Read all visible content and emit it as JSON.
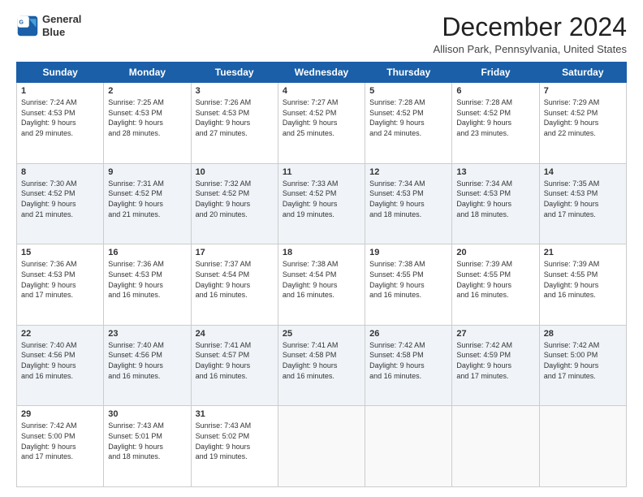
{
  "header": {
    "logo_line1": "General",
    "logo_line2": "Blue",
    "month": "December 2024",
    "location": "Allison Park, Pennsylvania, United States"
  },
  "days_of_week": [
    "Sunday",
    "Monday",
    "Tuesday",
    "Wednesday",
    "Thursday",
    "Friday",
    "Saturday"
  ],
  "weeks": [
    [
      {
        "day": "1",
        "lines": [
          "Sunrise: 7:24 AM",
          "Sunset: 4:53 PM",
          "Daylight: 9 hours",
          "and 29 minutes."
        ]
      },
      {
        "day": "2",
        "lines": [
          "Sunrise: 7:25 AM",
          "Sunset: 4:53 PM",
          "Daylight: 9 hours",
          "and 28 minutes."
        ]
      },
      {
        "day": "3",
        "lines": [
          "Sunrise: 7:26 AM",
          "Sunset: 4:53 PM",
          "Daylight: 9 hours",
          "and 27 minutes."
        ]
      },
      {
        "day": "4",
        "lines": [
          "Sunrise: 7:27 AM",
          "Sunset: 4:52 PM",
          "Daylight: 9 hours",
          "and 25 minutes."
        ]
      },
      {
        "day": "5",
        "lines": [
          "Sunrise: 7:28 AM",
          "Sunset: 4:52 PM",
          "Daylight: 9 hours",
          "and 24 minutes."
        ]
      },
      {
        "day": "6",
        "lines": [
          "Sunrise: 7:28 AM",
          "Sunset: 4:52 PM",
          "Daylight: 9 hours",
          "and 23 minutes."
        ]
      },
      {
        "day": "7",
        "lines": [
          "Sunrise: 7:29 AM",
          "Sunset: 4:52 PM",
          "Daylight: 9 hours",
          "and 22 minutes."
        ]
      }
    ],
    [
      {
        "day": "8",
        "lines": [
          "Sunrise: 7:30 AM",
          "Sunset: 4:52 PM",
          "Daylight: 9 hours",
          "and 21 minutes."
        ]
      },
      {
        "day": "9",
        "lines": [
          "Sunrise: 7:31 AM",
          "Sunset: 4:52 PM",
          "Daylight: 9 hours",
          "and 21 minutes."
        ]
      },
      {
        "day": "10",
        "lines": [
          "Sunrise: 7:32 AM",
          "Sunset: 4:52 PM",
          "Daylight: 9 hours",
          "and 20 minutes."
        ]
      },
      {
        "day": "11",
        "lines": [
          "Sunrise: 7:33 AM",
          "Sunset: 4:52 PM",
          "Daylight: 9 hours",
          "and 19 minutes."
        ]
      },
      {
        "day": "12",
        "lines": [
          "Sunrise: 7:34 AM",
          "Sunset: 4:53 PM",
          "Daylight: 9 hours",
          "and 18 minutes."
        ]
      },
      {
        "day": "13",
        "lines": [
          "Sunrise: 7:34 AM",
          "Sunset: 4:53 PM",
          "Daylight: 9 hours",
          "and 18 minutes."
        ]
      },
      {
        "day": "14",
        "lines": [
          "Sunrise: 7:35 AM",
          "Sunset: 4:53 PM",
          "Daylight: 9 hours",
          "and 17 minutes."
        ]
      }
    ],
    [
      {
        "day": "15",
        "lines": [
          "Sunrise: 7:36 AM",
          "Sunset: 4:53 PM",
          "Daylight: 9 hours",
          "and 17 minutes."
        ]
      },
      {
        "day": "16",
        "lines": [
          "Sunrise: 7:36 AM",
          "Sunset: 4:53 PM",
          "Daylight: 9 hours",
          "and 16 minutes."
        ]
      },
      {
        "day": "17",
        "lines": [
          "Sunrise: 7:37 AM",
          "Sunset: 4:54 PM",
          "Daylight: 9 hours",
          "and 16 minutes."
        ]
      },
      {
        "day": "18",
        "lines": [
          "Sunrise: 7:38 AM",
          "Sunset: 4:54 PM",
          "Daylight: 9 hours",
          "and 16 minutes."
        ]
      },
      {
        "day": "19",
        "lines": [
          "Sunrise: 7:38 AM",
          "Sunset: 4:55 PM",
          "Daylight: 9 hours",
          "and 16 minutes."
        ]
      },
      {
        "day": "20",
        "lines": [
          "Sunrise: 7:39 AM",
          "Sunset: 4:55 PM",
          "Daylight: 9 hours",
          "and 16 minutes."
        ]
      },
      {
        "day": "21",
        "lines": [
          "Sunrise: 7:39 AM",
          "Sunset: 4:55 PM",
          "Daylight: 9 hours",
          "and 16 minutes."
        ]
      }
    ],
    [
      {
        "day": "22",
        "lines": [
          "Sunrise: 7:40 AM",
          "Sunset: 4:56 PM",
          "Daylight: 9 hours",
          "and 16 minutes."
        ]
      },
      {
        "day": "23",
        "lines": [
          "Sunrise: 7:40 AM",
          "Sunset: 4:56 PM",
          "Daylight: 9 hours",
          "and 16 minutes."
        ]
      },
      {
        "day": "24",
        "lines": [
          "Sunrise: 7:41 AM",
          "Sunset: 4:57 PM",
          "Daylight: 9 hours",
          "and 16 minutes."
        ]
      },
      {
        "day": "25",
        "lines": [
          "Sunrise: 7:41 AM",
          "Sunset: 4:58 PM",
          "Daylight: 9 hours",
          "and 16 minutes."
        ]
      },
      {
        "day": "26",
        "lines": [
          "Sunrise: 7:42 AM",
          "Sunset: 4:58 PM",
          "Daylight: 9 hours",
          "and 16 minutes."
        ]
      },
      {
        "day": "27",
        "lines": [
          "Sunrise: 7:42 AM",
          "Sunset: 4:59 PM",
          "Daylight: 9 hours",
          "and 17 minutes."
        ]
      },
      {
        "day": "28",
        "lines": [
          "Sunrise: 7:42 AM",
          "Sunset: 5:00 PM",
          "Daylight: 9 hours",
          "and 17 minutes."
        ]
      }
    ],
    [
      {
        "day": "29",
        "lines": [
          "Sunrise: 7:42 AM",
          "Sunset: 5:00 PM",
          "Daylight: 9 hours",
          "and 17 minutes."
        ]
      },
      {
        "day": "30",
        "lines": [
          "Sunrise: 7:43 AM",
          "Sunset: 5:01 PM",
          "Daylight: 9 hours",
          "and 18 minutes."
        ]
      },
      {
        "day": "31",
        "lines": [
          "Sunrise: 7:43 AM",
          "Sunset: 5:02 PM",
          "Daylight: 9 hours",
          "and 19 minutes."
        ]
      },
      {
        "day": "",
        "lines": []
      },
      {
        "day": "",
        "lines": []
      },
      {
        "day": "",
        "lines": []
      },
      {
        "day": "",
        "lines": []
      }
    ]
  ]
}
